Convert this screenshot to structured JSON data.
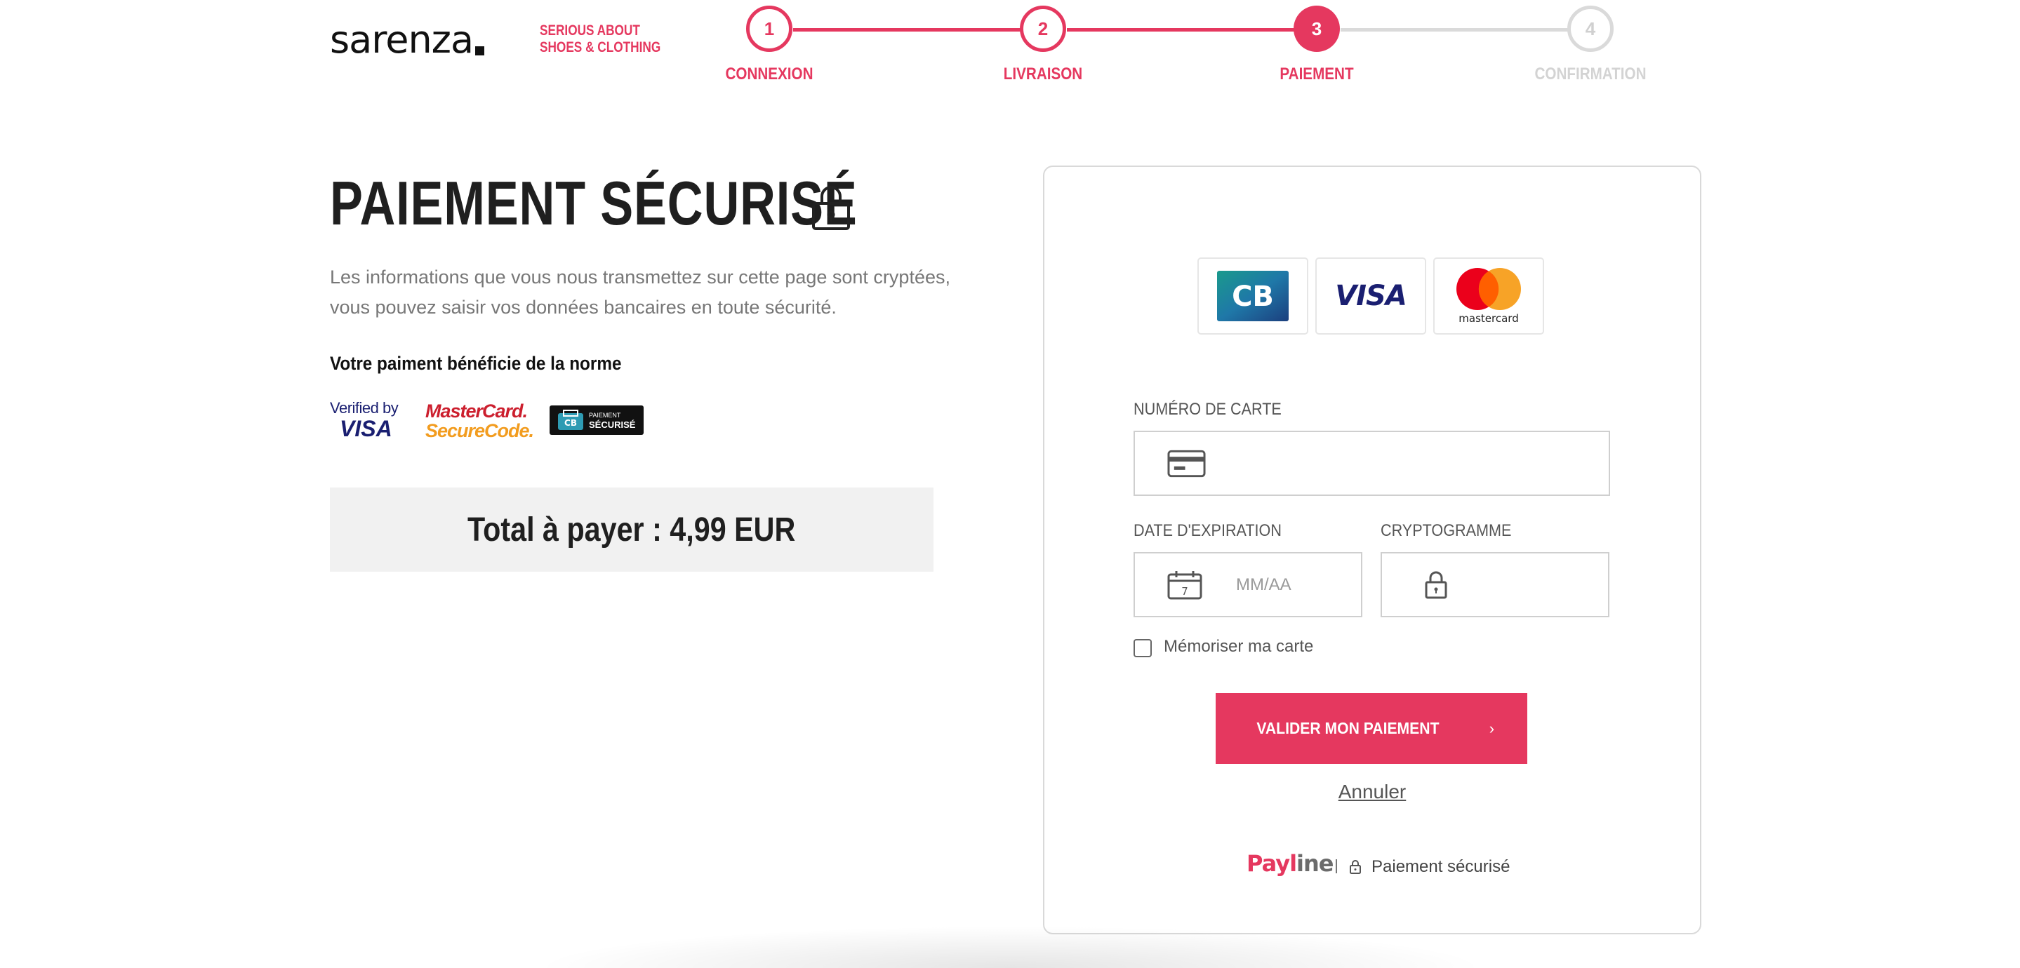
{
  "brand": {
    "logo_text": "sarenza",
    "tagline_line1": "SERIOUS ABOUT",
    "tagline_line2": "SHOES & CLOTHING"
  },
  "stepper": {
    "steps": [
      {
        "number": "1",
        "label": "CONNEXION",
        "state": "done"
      },
      {
        "number": "2",
        "label": "LIVRAISON",
        "state": "done"
      },
      {
        "number": "3",
        "label": "PAIEMENT",
        "state": "current"
      },
      {
        "number": "4",
        "label": "CONFIRMATION",
        "state": "todo"
      }
    ]
  },
  "left": {
    "title": "PAIEMENT SÉCURISÉ",
    "intro_line1": "Les informations que vous nous transmettez sur cette page sont cryptées,",
    "intro_line2": "vous pouvez saisir vos données bancaires en toute sécurité.",
    "norm_label": "Votre paiment bénéficie de la norme",
    "badges": {
      "vbv_line1": "Verified by",
      "vbv_line2": "VISA",
      "msc_line1": "MasterCard.",
      "msc_line2": "SecureCode.",
      "cb_line1": "PAIEMENT",
      "cb_line2": "SÉCURISÉ"
    },
    "total": "Total à payer : 4,99 EUR"
  },
  "form": {
    "card_brands": {
      "cb": "CB",
      "visa": "VISA",
      "mastercard": "mastercard"
    },
    "card_number_label": "NUMÉRO DE CARTE",
    "card_number_value": "",
    "expiry_label": "DATE D'EXPIRATION",
    "expiry_placeholder": "MM/AA",
    "expiry_calendar_day": "7",
    "cvv_label": "CRYPTOGRAMME",
    "cvv_value": "",
    "remember_label": "Mémoriser ma carte",
    "remember_checked": false,
    "submit_label": "VALIDER MON PAIEMENT",
    "submit_chevron": "›",
    "cancel_label": "Annuler",
    "provider_pay": "Payl",
    "provider_ine": "ine",
    "secure_label": "Paiement sécurisé"
  },
  "colors": {
    "accent": "#e5385f",
    "inactive": "#dadada",
    "total_bg": "#f1f1f1"
  },
  "icons": {
    "title": "lock-icon",
    "card_number": "credit-card-icon",
    "expiry": "calendar-icon",
    "cvv": "lock-icon",
    "footer": "lock-icon"
  }
}
